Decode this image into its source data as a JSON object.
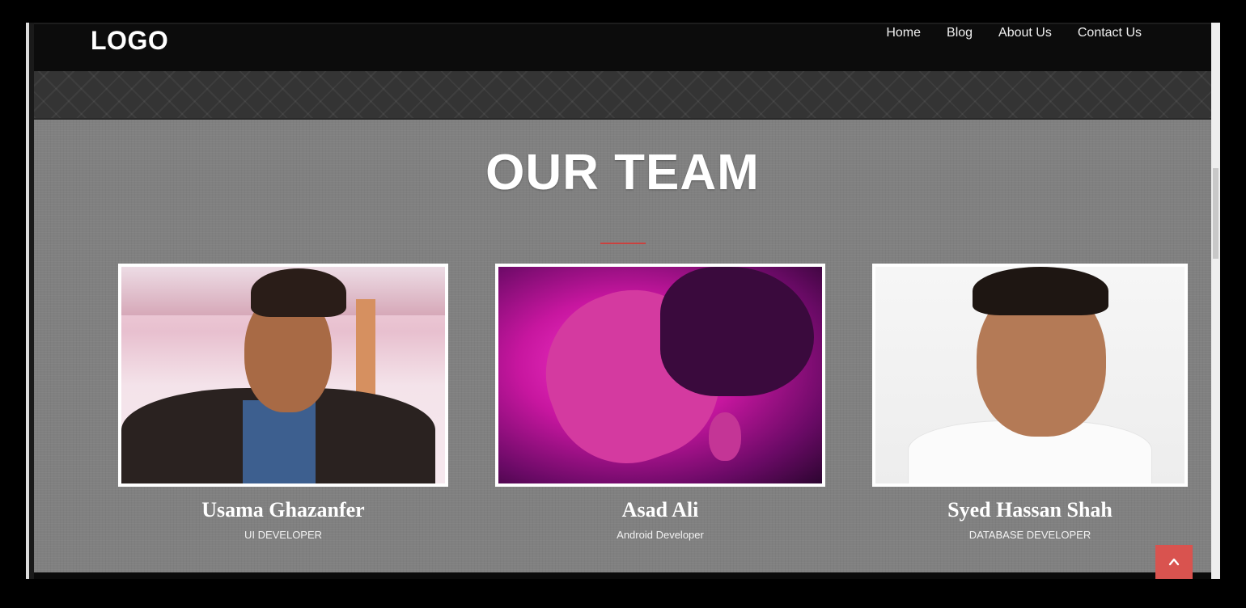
{
  "header": {
    "logo": "LOGO",
    "nav": [
      "Home",
      "Blog",
      "About Us",
      "Contact Us"
    ]
  },
  "section": {
    "title": "OUR TEAM",
    "accent_color": "#c9413e"
  },
  "team": [
    {
      "name": "Usama Ghazanfer",
      "role": "UI DEVELOPER"
    },
    {
      "name": "Asad Ali",
      "role": "Android Developer"
    },
    {
      "name": "Syed Hassan Shah",
      "role": "DATABASE DEVELOPER"
    }
  ],
  "scroll_top_icon": "chevron-up-icon"
}
